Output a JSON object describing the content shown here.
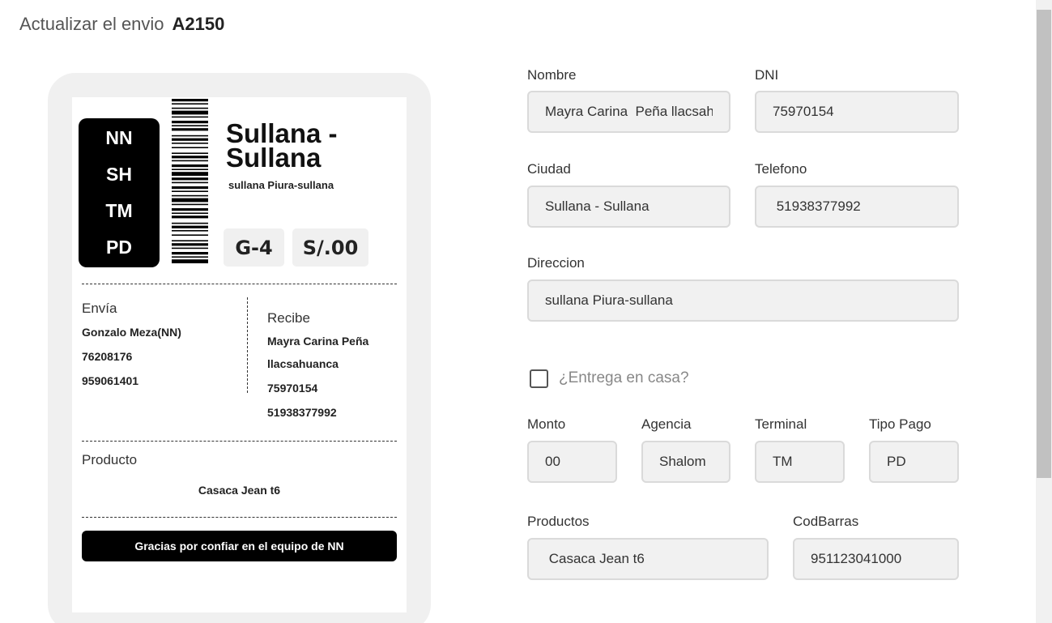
{
  "page": {
    "title_prefix": "Actualizar el envio",
    "shipment_code": "A2150"
  },
  "label": {
    "codes": [
      "NN",
      "SH",
      "TM",
      "PD"
    ],
    "city_title": "Sullana - Sullana",
    "city_address": "sullana Piura-sullana",
    "badge_group": "G-4",
    "badge_amount": "S/.00",
    "sender": {
      "heading": "Envía",
      "name": "Gonzalo Meza(NN)",
      "dni": "76208176",
      "phone": "959061401"
    },
    "receiver": {
      "heading": "Recibe",
      "name_line1": "Mayra Carina Peña",
      "name_line2": "llacsahuanca",
      "dni": "75970154",
      "phone": "51938377992"
    },
    "product": {
      "heading": "Producto",
      "value": "Casaca Jean t6"
    },
    "thanks": "Gracias por confiar en el equipo de NN"
  },
  "form": {
    "nombre": {
      "label": "Nombre",
      "value": "Mayra Carina  Peña llacsahuanca"
    },
    "dni": {
      "label": "DNI",
      "value": "75970154"
    },
    "ciudad": {
      "label": "Ciudad",
      "value": "Sullana - Sullana"
    },
    "telefono": {
      "label": "Telefono",
      "value": " 51938377992"
    },
    "direccion": {
      "label": "Direccion",
      "value": "sullana Piura-sullana"
    },
    "entrega": {
      "label": "¿Entrega en casa?",
      "checked": false
    },
    "monto": {
      "label": "Monto",
      "value": "00"
    },
    "agencia": {
      "label": "Agencia",
      "value": "Shalom"
    },
    "terminal": {
      "label": "Terminal",
      "value": "TM"
    },
    "tipo_pago": {
      "label": "Tipo Pago",
      "value": "PD"
    },
    "productos": {
      "label": "Productos",
      "value": " Casaca Jean t6"
    },
    "codbarras": {
      "label": "CodBarras",
      "value": "951123041000"
    }
  }
}
